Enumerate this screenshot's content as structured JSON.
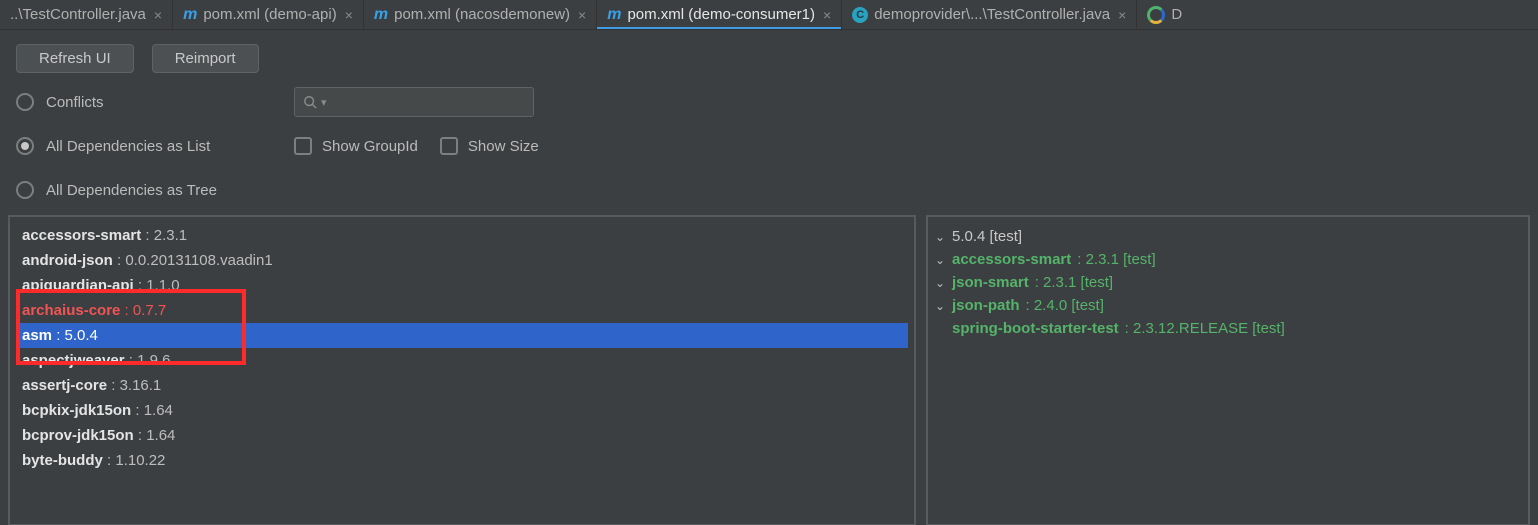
{
  "tabs": [
    {
      "label": "..\\TestController.java",
      "icon": null,
      "active": false
    },
    {
      "label": "pom.xml (demo-api)",
      "icon": "m",
      "active": false
    },
    {
      "label": "pom.xml (nacosdemonew)",
      "icon": "m",
      "active": false
    },
    {
      "label": "pom.xml (demo-consumer1)",
      "icon": "m",
      "active": true
    },
    {
      "label": "demoprovider\\...\\TestController.java",
      "icon": "c",
      "active": false
    },
    {
      "label": "D",
      "icon": "g",
      "active": false,
      "truncated": true
    }
  ],
  "toolbar": {
    "refresh_label": "Refresh UI",
    "reimport_label": "Reimport",
    "radio_conflicts": "Conflicts",
    "radio_list": "All Dependencies as List",
    "radio_tree": "All Dependencies as Tree",
    "show_groupid": "Show GroupId",
    "show_size": "Show Size",
    "search_placeholder": ""
  },
  "dependencies": [
    {
      "name": "accessors-smart",
      "version": "2.3.1",
      "selected": false,
      "warn": false
    },
    {
      "name": "android-json",
      "version": "0.0.20131108.vaadin1",
      "selected": false,
      "warn": false
    },
    {
      "name": "apiguardian-api",
      "version": "1.1.0",
      "selected": false,
      "warn": false
    },
    {
      "name": "archaius-core",
      "version": "0.7.7",
      "selected": false,
      "warn": true
    },
    {
      "name": "asm",
      "version": "5.0.4",
      "selected": true,
      "warn": false
    },
    {
      "name": "aspectjweaver",
      "version": "1.9.6",
      "selected": false,
      "warn": false
    },
    {
      "name": "assertj-core",
      "version": "3.16.1",
      "selected": false,
      "warn": false
    },
    {
      "name": "bcpkix-jdk15on",
      "version": "1.64",
      "selected": false,
      "warn": false
    },
    {
      "name": "bcprov-jdk15on",
      "version": "1.64",
      "selected": false,
      "warn": false
    },
    {
      "name": "byte-buddy",
      "version": "1.10.22",
      "selected": false,
      "warn": false
    }
  ],
  "tree": {
    "root": {
      "text": "5.0.4 [test]"
    },
    "nodes": [
      {
        "indent": 1,
        "name": "accessors-smart",
        "rest": " : 2.3.1 [test]"
      },
      {
        "indent": 2,
        "name": "json-smart",
        "rest": " : 2.3.1 [test]"
      },
      {
        "indent": 3,
        "name": "json-path",
        "rest": " : 2.4.0 [test]"
      },
      {
        "indent": 4,
        "name": "spring-boot-starter-test",
        "rest": " : 2.3.12.RELEASE [test]",
        "leaf": true
      }
    ]
  }
}
